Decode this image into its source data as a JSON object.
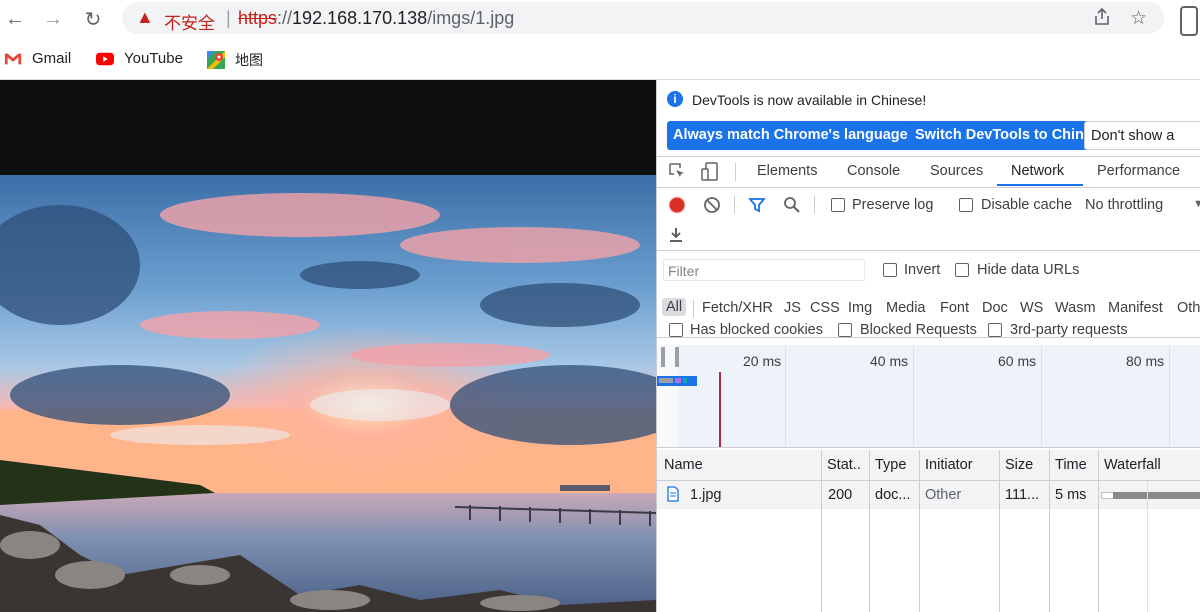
{
  "browser": {
    "security_label": "不安全",
    "url_scheme": "https",
    "url_rest_prefix": "://",
    "url_host": "192.168.170.138",
    "url_path": "/imgs/1.jpg",
    "icons": {
      "back": "back-arrow-icon",
      "forward": "forward-arrow-icon",
      "reload": "reload-icon",
      "warning": "warning-triangle-icon",
      "share": "share-icon",
      "bookmark": "star-icon"
    }
  },
  "bookmarks": [
    {
      "label": "Gmail",
      "icon": "gmail-icon"
    },
    {
      "label": "YouTube",
      "icon": "youtube-icon"
    },
    {
      "label": "地图",
      "icon": "maps-icon"
    }
  ],
  "devtools": {
    "banner": {
      "message": "DevTools is now available in Chinese!",
      "buttons": [
        "Always match Chrome's language",
        "Switch DevTools to Chinese",
        "Don't show a"
      ]
    },
    "tabs": [
      "Elements",
      "Console",
      "Sources",
      "Network",
      "Performance"
    ],
    "active_tab": "Network",
    "toolbar": {
      "preserve_log": "Preserve log",
      "disable_cache": "Disable cache",
      "throttling": "No throttling"
    },
    "filter": {
      "placeholder": "Filter",
      "invert": "Invert",
      "hide_data_urls": "Hide data URLs",
      "types": [
        "All",
        "Fetch/XHR",
        "JS",
        "CSS",
        "Img",
        "Media",
        "Font",
        "Doc",
        "WS",
        "Wasm",
        "Manifest",
        "Oth"
      ],
      "has_blocked_cookies": "Has blocked cookies",
      "blocked_requests": "Blocked Requests",
      "third_party": "3rd-party requests"
    },
    "overview": {
      "ticks": [
        "20 ms",
        "40 ms",
        "60 ms",
        "80 ms"
      ]
    },
    "table": {
      "headers": [
        "Name",
        "Stat..",
        "Type",
        "Initiator",
        "Size",
        "Time",
        "Waterfall"
      ],
      "rows": [
        {
          "name": "1.jpg",
          "status": "200",
          "type": "doc...",
          "initiator": "Other",
          "size": "111...",
          "time": "5 ms"
        }
      ]
    },
    "colors": {
      "accent": "#1a73e8",
      "record": "#d93025"
    }
  }
}
